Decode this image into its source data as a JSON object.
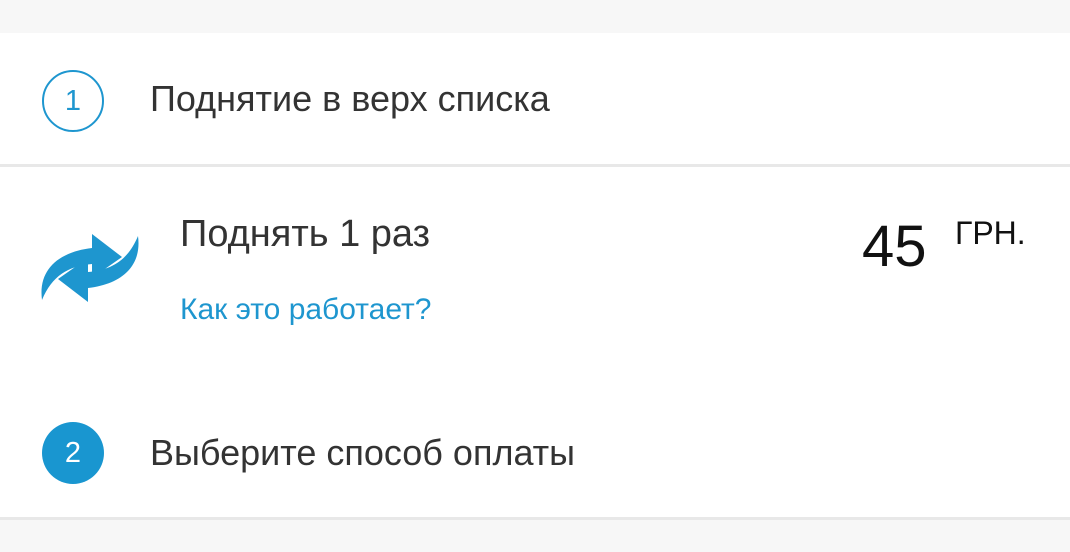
{
  "steps": {
    "step1": {
      "number": "1",
      "title": "Поднятие в верх списка"
    },
    "step2": {
      "number": "2",
      "title": "Выберите способ оплаты"
    }
  },
  "option": {
    "icon": "refresh-arrows-icon",
    "title": "Поднять 1 раз",
    "help_link": "Как это работает?",
    "price": {
      "amount": "45",
      "currency": "ГРН."
    }
  },
  "colors": {
    "accent": "#1e96cf",
    "text_primary": "#333333",
    "background": "#f7f7f7",
    "divider": "#e8e8e8"
  }
}
